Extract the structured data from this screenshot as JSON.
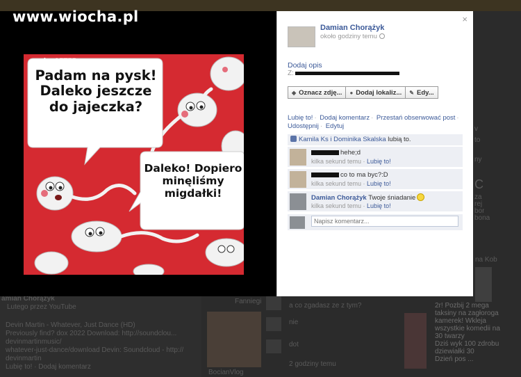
{
  "watermark": "www.wiocha.pl",
  "photo": {
    "credit": "..by AFTER",
    "bubble1": [
      "Padam na pysk!",
      "Daleko jeszcze",
      "do jajeczka?"
    ],
    "bubble2": [
      "Daleko! Dopiero",
      "minęliśmy",
      "migdałki!"
    ]
  },
  "panel": {
    "close_label": "×",
    "author": "Damian Chorążyk",
    "time": "około godziny temu",
    "add_description": "Dodaj opis",
    "from_prefix": "Z:",
    "buttons": [
      {
        "label": "Oznacz zdję...",
        "icon": "tag-icon"
      },
      {
        "label": "Dodaj lokaliz...",
        "icon": "location-pin-icon"
      },
      {
        "label": "Edy...",
        "icon": "pencil-icon"
      }
    ],
    "actions": [
      "Lubię to!",
      "Dodaj komentarz",
      "Przestań obserwować post",
      "Udostępnij",
      "Edytuj"
    ],
    "likes": {
      "names": "Kamila Ks i Dominika Skalska",
      "suffix": "lubią to."
    },
    "comments": [
      {
        "author": "",
        "text": "hehe;d",
        "time": "kilka sekund temu",
        "like": "Lubię to!"
      },
      {
        "author": "",
        "text": "co to ma byc?:D",
        "time": "kilka sekund temu",
        "like": "Lubię to!"
      },
      {
        "author": "Damian Chorążyk",
        "text": "Twoje śniadanie",
        "time": "kilka sekund temu",
        "like": "Lubię to!"
      }
    ],
    "comment_placeholder": "Napisz komentarz..."
  },
  "background": {
    "header_name": "amian Chorążyk",
    "header_meta": "Lutego przez YouTube",
    "lines": [
      "Devin Martin - Whatever, Just Dance (HD)",
      "Previously find? dox 2022 Download: http://soundclou...",
      "devinmartinmusic/",
      "whatever-just-dance/download Devin: Soundcloud - http://",
      "devinmartin",
      "Lubię to! · Dodaj komentarz"
    ],
    "right_lines": [
      "v",
      "to",
      "ny",
      "C",
      "za",
      "rej",
      "bor",
      "bona"
    ],
    "feed_a": "a co zgadasz ze z tym?",
    "feed_b": "nie",
    "feed_c": "dot",
    "feed_d": "2 godziny temu",
    "friend_name": "BocianVlog",
    "item_label": "Fanniegi",
    "side_label": "na Kob",
    "side_text": [
      "2r! Pozbij 2 mega",
      "taksiny na zagłoroga",
      "kamerek! Wkleja",
      "wszystkie komedii na",
      "30 twarzy",
      "Dziś wyk 100 zdrobu",
      "dziewiałki 30",
      "Dzień pos ..."
    ]
  }
}
